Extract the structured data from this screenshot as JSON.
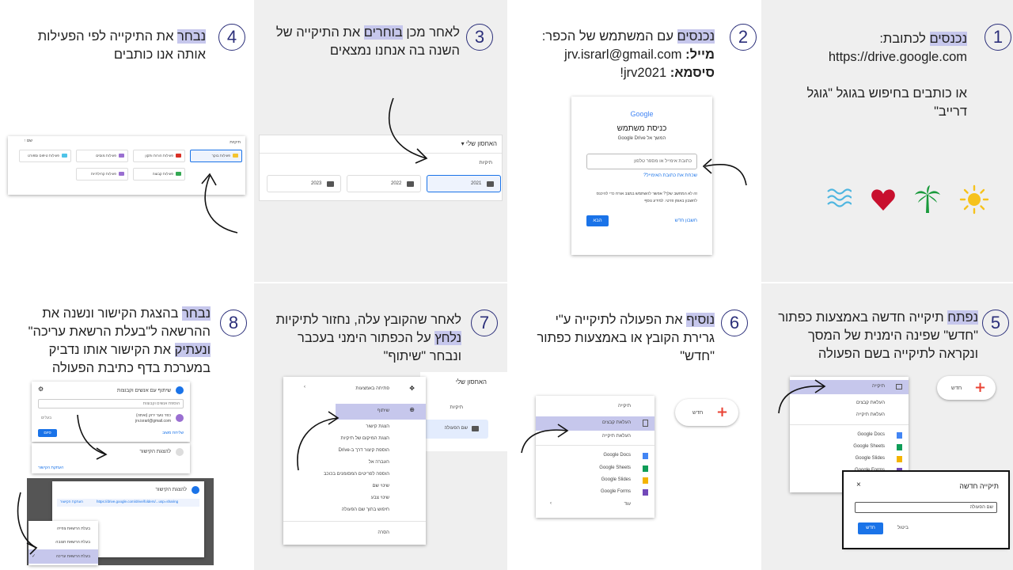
{
  "steps": [
    {
      "number": "1",
      "lines": [
        {
          "hl": "נכנסים",
          "rest": " לכתובת:"
        },
        {
          "plain": "https://drive.google.com"
        },
        {
          "plain": ""
        },
        {
          "plain": "או כותבים בחיפוש בגוגל \"גוגל"
        },
        {
          "plain": "דרייב\""
        }
      ],
      "decorations": [
        "water-waves",
        "heart",
        "palm-tree",
        "sun"
      ]
    },
    {
      "number": "2",
      "line1_hl": "נכנסים",
      "line1_rest": " עם המשתמש של הכפר:",
      "mail_label": "מייל:",
      "mail_value": " jrv.israrl@gmail.com",
      "pass_label": "סיסמא:",
      "pass_value": " jrv2021!",
      "shot": {
        "logo": "Google",
        "title": "כניסת משתמש",
        "subtitle": "המשך אל Google Drive",
        "field_placeholder": "כתובת אימייל או מספר טלפון",
        "forgot": "שכחת את כתובת האימייל?",
        "note_line1": "זה לא המחשב שלך? אפשר להשתמש במצב אורח כדי להיכנס",
        "note_line2": "לחשבון באופן פרטי. למידע נוסף",
        "create": "חשבון חדש",
        "next": "הבא"
      }
    },
    {
      "number": "3",
      "line1_pre": "לאחר מכן ",
      "line1_hl": "בוחרים",
      "line1_rest": " את התיקייה של",
      "line2": "השנה בה אנחנו נמצאים",
      "shot": {
        "header": "האחסון שלי",
        "section": "תיקיות",
        "folders": [
          "2021",
          "2022",
          "2023"
        ]
      }
    },
    {
      "number": "4",
      "line1_hl": "נבחר",
      "line1_rest": " את התיקייה לפי הפעילות",
      "line2": "אותה אנו כותבים",
      "shot": {
        "section": "תיקיות",
        "sort": "שם",
        "folders": [
          "פעילות בוקר",
          "פעילות הורות ותקון",
          "פעילות מוסים",
          "פעילות טיפוס וספורט",
          "פעילות קבוצה",
          "פעילות קהילתיות"
        ]
      }
    },
    {
      "number": "5",
      "line1_hl": "נפתח",
      "line1_rest": " תיקייה חדשה באמצעות כפתור",
      "line2": "\"חדש\" שפינה הימנית של המסך",
      "line3": "ונקראה לתיקייה בשם הפעולה",
      "shot": {
        "new_btn": "חדש",
        "menu": [
          "תיקייה",
          "העלאת קבצים",
          "העלאת תיקייה",
          "Google Docs",
          "Google Sheets",
          "Google Slides",
          "Google Forms"
        ],
        "dialog_title": "תיקייה חדשה",
        "dialog_value": "שם הפעולה",
        "cancel": "ביטול",
        "create": "חדש"
      }
    },
    {
      "number": "6",
      "line1_hl": "נוסיף",
      "line1_rest": " את הפעולה לתיקייה ע\"י",
      "line2": "גרירת הקובץ או באמצעות כפתור",
      "line3": "\"חדש\"",
      "shot": {
        "new_btn": "חדש",
        "menu": [
          "תיקייה",
          "העלאת קבצים",
          "העלאת תיקייה",
          "Google Docs",
          "Google Sheets",
          "Google Slides",
          "Google Forms",
          "עוד"
        ]
      }
    },
    {
      "number": "7",
      "line1": "לאחר שהקובץ עלה, נחזור לתיקיות",
      "line2_hl": "נלחץ",
      "line2_rest": " על הכפתור הימני בעכבר",
      "line3": "ונבחר \"שיתוף\"",
      "shot": {
        "header": "האחסון שלי",
        "section": "תיקיות",
        "file": "שם הפעולה",
        "menu": [
          "פתיחה באמצעות",
          "שיתוף",
          "הצגת קישור",
          "הצגת המיקום של תיקיות",
          "הוספת קיצור דרך ב-Drive",
          "העברה אל",
          "הוספה לפריטים המסומנים בכוכב",
          "שינוי שם",
          "שינוי צבע",
          "חיפוש בתוך שם הפעולה",
          "הסרה"
        ]
      }
    },
    {
      "number": "8",
      "line1_hl": "נבחר",
      "line1_rest": " בהצגת הקישור ונשנה את",
      "line2": "ההרשאה ל\"בעלת הרשאת עריכה\"",
      "line3_hl": "ונעתיק",
      "line3_rest": " את הקישור אותו נדביק",
      "line4": "במערכת בדף כתיבת הפעולה",
      "shot": {
        "share_title": "שיתוף עם אנשים וקבוצות",
        "add_people": "הוספת אנשים וקבוצות",
        "owner": "כפר נוער ירוק (ואתה)",
        "owner_mail": "jrv.israrl@gmail.com",
        "owner_role": "בעלים",
        "done": "סיום",
        "send_feedback": "שליחת משוב",
        "link_title": "להצגת הקישור",
        "link_box_title": "להצגת הקישור",
        "copy_link": "העתקת הקישור",
        "link_url": "https://drive.google.com/drive/folders/...usp=sharing",
        "roles": [
          "בעלת הרשאת צפייה",
          "בעלת הרשאת תגובה",
          "בעלת הרשאת עריכה"
        ]
      }
    }
  ]
}
